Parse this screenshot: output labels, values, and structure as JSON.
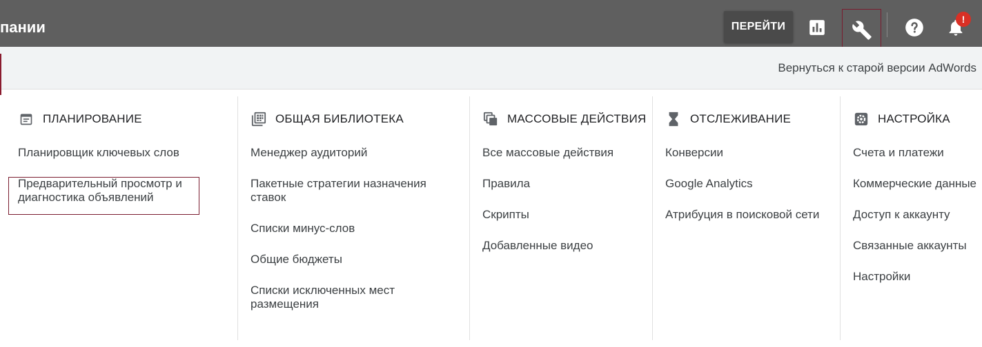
{
  "topbar": {
    "title": "пании",
    "goto_label": "ПЕРЕЙТИ",
    "notification_badge": "!",
    "icons": [
      "reports-icon",
      "tools-icon",
      "help-icon",
      "notifications-icon"
    ]
  },
  "subbar": {
    "old_version_link": "Вернуться к старой версии AdWords"
  },
  "columns": [
    {
      "header": "ПЛАНИРОВАНИЕ",
      "icon": "calendar-icon",
      "items": [
        "Планировщик ключевых слов",
        "Предварительный просмотр и диагностика объявлений"
      ]
    },
    {
      "header": "ОБЩАЯ БИБЛИОТЕКА",
      "icon": "library-icon",
      "items": [
        "Менеджер аудиторий",
        "Пакетные стратегии назначения ставок",
        "Списки минус-слов",
        "Общие бюджеты",
        "Списки исключенных мест размещения"
      ]
    },
    {
      "header": "МАССОВЫЕ ДЕЙСТВИЯ",
      "icon": "bulk-actions-icon",
      "items": [
        "Все массовые действия",
        "Правила",
        "Скрипты",
        "Добавленные видео"
      ]
    },
    {
      "header": "ОТСЛЕЖИВАНИЕ",
      "icon": "hourglass-icon",
      "items": [
        "Конверсии",
        "Google Analytics",
        "Атрибуция в поисковой сети"
      ]
    },
    {
      "header": "НАСТРОЙКА",
      "icon": "settings-gear-icon",
      "items": [
        "Счета и платежи",
        "Коммерческие данные",
        "Доступ к аккаунту",
        "Связанные аккаунты",
        "Настройки"
      ]
    }
  ],
  "colors": {
    "topbar_bg": "#5f5f5f",
    "subbar_bg": "#f1f3f4",
    "highlight_border": "#7a1b2e",
    "badge": "#d93025"
  }
}
